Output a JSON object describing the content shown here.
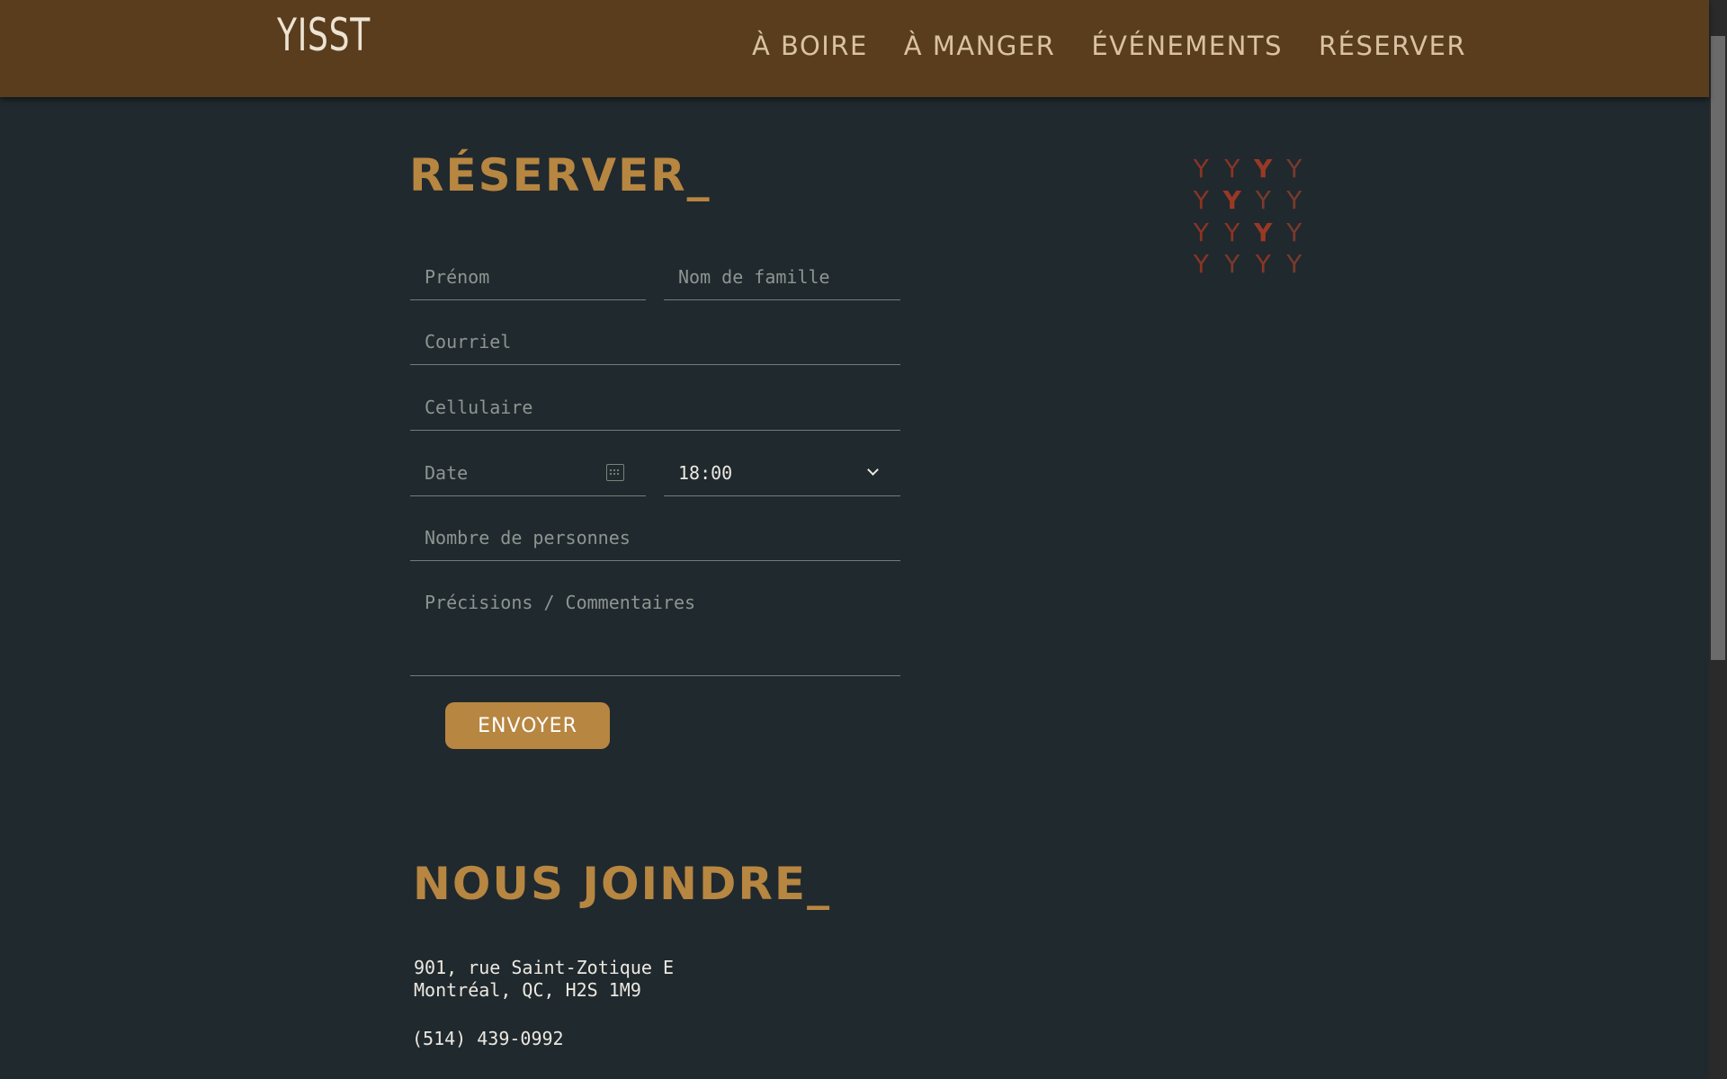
{
  "header": {
    "logo": "YISST",
    "nav": [
      "À BOIRE",
      "À MANGER",
      "ÉVÉNEMENTS",
      "RÉSERVER"
    ]
  },
  "reserve": {
    "title": "RÉSERVER_",
    "fields": {
      "prenom": "Prénom",
      "nom": "Nom de famille",
      "courriel": "Courriel",
      "cellulaire": "Cellulaire",
      "date": "Date",
      "time": "18:00",
      "nombre": "Nombre de personnes",
      "precisions": "Précisions / Commentaires"
    },
    "submit": "ENVOYER"
  },
  "contact": {
    "title": "NOUS JOINDRE_",
    "address_line1": "901, rue Saint-Zotique E",
    "address_line2": "Montréal, QC, H2S 1M9",
    "phone": "(514) 439-0992"
  },
  "colors": {
    "header": "#5a3d1d",
    "background": "#20292e",
    "accent": "#b78641",
    "decor": "#8c3424"
  }
}
